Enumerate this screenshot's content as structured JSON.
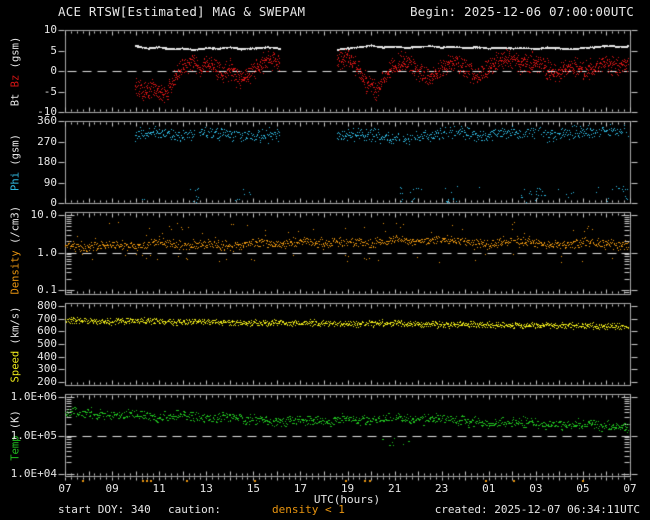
{
  "header": {
    "title": "ACE RTSW[Estimated] MAG & SWEPAM",
    "begin_label": "Begin: 2025-12-06 07:00:00UTC"
  },
  "x_axis": {
    "label": "UTC(hours)",
    "tick_labels": [
      "07",
      "09",
      "11",
      "13",
      "15",
      "17",
      "19",
      "21",
      "23",
      "01",
      "03",
      "05",
      "07"
    ],
    "hours_span": 24
  },
  "footer": {
    "start_doy": "start DOY: 340",
    "caution_label": "caution:",
    "caution_value": "density < 1",
    "created": "created: 2025-12-07 06:34:11UTC"
  },
  "colors": {
    "background": "#000000",
    "frame": "#a8a8a8",
    "ticks": "#c8c8c8",
    "text": "#e6e6e6",
    "dashed_line": "#e0e0e0",
    "caution": "#e8940f"
  },
  "chart_data": [
    {
      "id": "mag-bt-bz",
      "type": "scatter",
      "scale": "linear",
      "ylim": [
        -10,
        10
      ],
      "yticks": [
        10,
        5,
        0,
        -5,
        -10
      ],
      "ytick_labels": [
        "10",
        "5",
        "0",
        "-5",
        "-10"
      ],
      "ylabel_parts": [
        {
          "text": "Bt ",
          "color": "#e6e6e6"
        },
        {
          "text": "Bz",
          "color": "#d41414"
        },
        {
          "text": " (gsm)",
          "color": "#e6e6e6"
        }
      ],
      "dashed_at": 0,
      "series": [
        {
          "name": "Bt",
          "color": "#e6e6e6",
          "dt": 0.015,
          "per": 2,
          "noise": 0.22,
          "size": 1,
          "segments": [
            [
              2.97,
              9.13
            ],
            [
              11.55,
              23.93
            ]
          ],
          "keypoints": [
            [
              2.97,
              6.2
            ],
            [
              3.5,
              5.6
            ],
            [
              4,
              5.9
            ],
            [
              4.5,
              5.4
            ],
            [
              5,
              5.6
            ],
            [
              5.5,
              5.3
            ],
            [
              6,
              5.7
            ],
            [
              6.5,
              5.5
            ],
            [
              7,
              5.9
            ],
            [
              7.5,
              5.4
            ],
            [
              8,
              5.6
            ],
            [
              8.6,
              5.9
            ],
            [
              9.13,
              5.5
            ],
            [
              11.55,
              5.3
            ],
            [
              12,
              5.6
            ],
            [
              12.5,
              5.9
            ],
            [
              13,
              6.3
            ],
            [
              13.5,
              5.8
            ],
            [
              14,
              6.1
            ],
            [
              14.5,
              5.7
            ],
            [
              15,
              6.0
            ],
            [
              15.5,
              6.2
            ],
            [
              16,
              5.8
            ],
            [
              16.5,
              6.0
            ],
            [
              17,
              5.7
            ],
            [
              17.5,
              5.9
            ],
            [
              18,
              5.6
            ],
            [
              18.5,
              5.8
            ],
            [
              19,
              5.6
            ],
            [
              19.5,
              5.7
            ],
            [
              20,
              5.5
            ],
            [
              20.5,
              5.8
            ],
            [
              21,
              5.6
            ],
            [
              21.5,
              5.4
            ],
            [
              22,
              5.7
            ],
            [
              22.5,
              5.9
            ],
            [
              23,
              6.2
            ],
            [
              23.5,
              6.0
            ],
            [
              23.93,
              6.1
            ]
          ]
        },
        {
          "name": "Bz",
          "color": "#d41414",
          "dt": 0.022,
          "per": 2,
          "noise": 2.8,
          "size": 1,
          "clip": [
            -9.5,
            9.5
          ],
          "segments": [
            [
              2.97,
              9.13
            ],
            [
              11.55,
              23.93
            ]
          ],
          "keypoints": [
            [
              2.97,
              -3
            ],
            [
              3.3,
              -5.5
            ],
            [
              3.7,
              -4
            ],
            [
              4.2,
              -6
            ],
            [
              4.6,
              -2
            ],
            [
              5,
              1
            ],
            [
              5.4,
              2.5
            ],
            [
              5.8,
              0.5
            ],
            [
              6.2,
              2
            ],
            [
              6.6,
              -1
            ],
            [
              7,
              0.5
            ],
            [
              7.4,
              -2.5
            ],
            [
              7.8,
              -1
            ],
            [
              8.2,
              1
            ],
            [
              8.6,
              3
            ],
            [
              9.13,
              2
            ],
            [
              11.55,
              2.5
            ],
            [
              12,
              3.5
            ],
            [
              12.4,
              1
            ],
            [
              12.8,
              -3
            ],
            [
              13.2,
              -4.5
            ],
            [
              13.6,
              -1
            ],
            [
              14,
              1.5
            ],
            [
              14.5,
              2.5
            ],
            [
              15,
              0
            ],
            [
              15.5,
              -2
            ],
            [
              16,
              1
            ],
            [
              16.5,
              2
            ],
            [
              17,
              0.5
            ],
            [
              17.5,
              -1.5
            ],
            [
              18,
              1
            ],
            [
              18.5,
              2.5
            ],
            [
              19,
              3
            ],
            [
              19.5,
              1.5
            ],
            [
              20,
              2.5
            ],
            [
              20.5,
              0.5
            ],
            [
              21,
              -0.5
            ],
            [
              21.5,
              1.5
            ],
            [
              22,
              0
            ],
            [
              22.5,
              1
            ],
            [
              23,
              2
            ],
            [
              23.5,
              1
            ],
            [
              23.93,
              1.5
            ]
          ]
        }
      ]
    },
    {
      "id": "mag-phi",
      "type": "scatter",
      "scale": "linear",
      "ylim": [
        0,
        360
      ],
      "yticks": [
        360,
        270,
        180,
        90,
        0
      ],
      "ytick_labels": [
        "360",
        "270",
        "180",
        "90",
        "0"
      ],
      "ylabel_parts": [
        {
          "text": "Phi",
          "color": "#2fb8e0"
        },
        {
          "text": " (gsm)",
          "color": "#e6e6e6"
        }
      ],
      "dashed_at": null,
      "series": [
        {
          "name": "Phi",
          "color": "#2fb8e0",
          "dt": 0.022,
          "per": 1,
          "noise": 35,
          "size": 1,
          "clip": [
            0,
            360
          ],
          "segments": [
            [
              2.97,
              9.13
            ],
            [
              11.55,
              23.93
            ]
          ],
          "keypoints": [
            [
              2.97,
              300
            ],
            [
              4,
              310
            ],
            [
              5,
              295
            ],
            [
              6,
              315
            ],
            [
              7,
              300
            ],
            [
              8,
              290
            ],
            [
              9.13,
              305
            ],
            [
              11.55,
              295
            ],
            [
              12.5,
              310
            ],
            [
              13.5,
              290
            ],
            [
              14.5,
              282
            ],
            [
              15.5,
              300
            ],
            [
              16.5,
              310
            ],
            [
              17.5,
              295
            ],
            [
              18.5,
              305
            ],
            [
              19.5,
              315
            ],
            [
              20.5,
              300
            ],
            [
              21.5,
              310
            ],
            [
              22.5,
              320
            ],
            [
              23.93,
              310
            ]
          ],
          "low_clusters": [
            [
              3.0,
              3.7
            ],
            [
              5.2,
              5.7
            ],
            [
              7.2,
              7.9
            ],
            [
              14.2,
              15.2
            ],
            [
              16.1,
              16.7
            ],
            [
              19.3,
              20.4
            ],
            [
              21.1,
              21.7
            ],
            [
              23.1,
              23.9
            ]
          ],
          "low_prob_in": 0.3,
          "low_prob_out": 0.01,
          "low_range": [
            2,
            75
          ]
        }
      ]
    },
    {
      "id": "density",
      "type": "scatter",
      "scale": "log",
      "ylim": [
        0.08,
        12
      ],
      "yticks": [
        10,
        1,
        0.1
      ],
      "ytick_labels": [
        "10.0",
        "1.0",
        "0.1"
      ],
      "ylabel_parts": [
        {
          "text": "Density",
          "color": "#e8940f"
        },
        {
          "text": " (/cm3)",
          "color": "#e6e6e6"
        }
      ],
      "dashed_at": 1,
      "series": [
        {
          "name": "Density",
          "color": "#e8940f",
          "dt": 0.02,
          "per": 1,
          "noise": 0.15,
          "size": 1,
          "clip": [
            0.1,
            9
          ],
          "segments": [
            [
              0,
              23.93
            ]
          ],
          "keypoints": [
            [
              0,
              1.6
            ],
            [
              1,
              1.4
            ],
            [
              2,
              1.7
            ],
            [
              3,
              1.5
            ],
            [
              4,
              2.0
            ],
            [
              5,
              1.6
            ],
            [
              6,
              1.8
            ],
            [
              7,
              1.5
            ],
            [
              8,
              1.9
            ],
            [
              9,
              1.6
            ],
            [
              10,
              2.1
            ],
            [
              11,
              1.7
            ],
            [
              12,
              2.0
            ],
            [
              13,
              1.8
            ],
            [
              14,
              2.3
            ],
            [
              15,
              1.9
            ],
            [
              16,
              2.4
            ],
            [
              17,
              2.0
            ],
            [
              18,
              1.7
            ],
            [
              19,
              2.1
            ],
            [
              20,
              1.8
            ],
            [
              21,
              1.6
            ],
            [
              22,
              1.9
            ],
            [
              23,
              1.7
            ],
            [
              23.93,
              1.6
            ]
          ],
          "below_prob": 0.035,
          "below_range": [
            0.5,
            0.92
          ],
          "spike_prob": 0.05,
          "spike_mult": [
            1.4,
            3.2
          ],
          "caution_marks": true
        }
      ]
    },
    {
      "id": "speed",
      "type": "scatter",
      "scale": "linear",
      "ylim": [
        176,
        824
      ],
      "yticks": [
        800,
        700,
        600,
        500,
        400,
        300,
        200
      ],
      "ytick_labels": [
        "800",
        "700",
        "600",
        "500",
        "400",
        "300",
        "200"
      ],
      "ylabel_parts": [
        {
          "text": "Speed",
          "color": "#ece819"
        },
        {
          "text": " (km/s)",
          "color": "#e6e6e6"
        }
      ],
      "dashed_at": null,
      "series": [
        {
          "name": "Speed",
          "color": "#ece819",
          "dt": 0.018,
          "per": 1,
          "noise": 30,
          "size": 1,
          "clip": [
            200,
            800
          ],
          "segments": [
            [
              0,
              23.93
            ]
          ],
          "keypoints": [
            [
              0,
              690
            ],
            [
              1,
              685
            ],
            [
              2,
              680
            ],
            [
              3,
              688
            ],
            [
              4,
              682
            ],
            [
              5,
              676
            ],
            [
              6,
              680
            ],
            [
              7,
              672
            ],
            [
              8,
              668
            ],
            [
              9,
              672
            ],
            [
              10,
              665
            ],
            [
              11,
              668
            ],
            [
              12,
              660
            ],
            [
              13,
              665
            ],
            [
              14,
              668
            ],
            [
              15,
              658
            ],
            [
              16,
              655
            ],
            [
              17,
              660
            ],
            [
              18,
              652
            ],
            [
              19,
              648
            ],
            [
              20,
              652
            ],
            [
              21,
              648
            ],
            [
              22,
              645
            ],
            [
              23,
              642
            ],
            [
              23.93,
              638
            ]
          ]
        }
      ]
    },
    {
      "id": "temp",
      "type": "scatter",
      "scale": "log",
      "ylim": [
        8900,
        1200000
      ],
      "yticks": [
        1000000,
        100000,
        10000
      ],
      "ytick_labels": [
        "1.0E+06",
        "1.0E+05",
        "1.0E+04"
      ],
      "ylabel_parts": [
        {
          "text": "Temp",
          "color": "#1fbf1f"
        },
        {
          "text": " (K)",
          "color": "#e6e6e6"
        }
      ],
      "dashed_at": 100000,
      "series": [
        {
          "name": "Temp",
          "color": "#1fbf1f",
          "dt": 0.025,
          "per": 1,
          "noise": 0.16,
          "size": 1,
          "clip": [
            10500,
            950000
          ],
          "segments": [
            [
              0,
              23.93
            ]
          ],
          "keypoints": [
            [
              0,
              420000
            ],
            [
              1,
              380000
            ],
            [
              2,
              330000
            ],
            [
              3,
              360000
            ],
            [
              4,
              300000
            ],
            [
              5,
              340000
            ],
            [
              6,
              290000
            ],
            [
              7,
              320000
            ],
            [
              8,
              260000
            ],
            [
              9,
              230000
            ],
            [
              10,
              260000
            ],
            [
              11,
              240000
            ],
            [
              12,
              280000
            ],
            [
              13,
              250000
            ],
            [
              14,
              300000
            ],
            [
              15,
              260000
            ],
            [
              16,
              280000
            ],
            [
              17,
              240000
            ],
            [
              18,
              200000
            ],
            [
              19,
              230000
            ],
            [
              20,
              210000
            ],
            [
              21,
              190000
            ],
            [
              22,
              210000
            ],
            [
              23,
              180000
            ],
            [
              23.93,
              170000
            ]
          ],
          "out_clusters": [
            [
              13.4,
              14.6
            ]
          ],
          "out_prob": 0.12,
          "out_range": [
            45000,
            90000
          ],
          "wide_prob": 0.3
        }
      ]
    }
  ]
}
